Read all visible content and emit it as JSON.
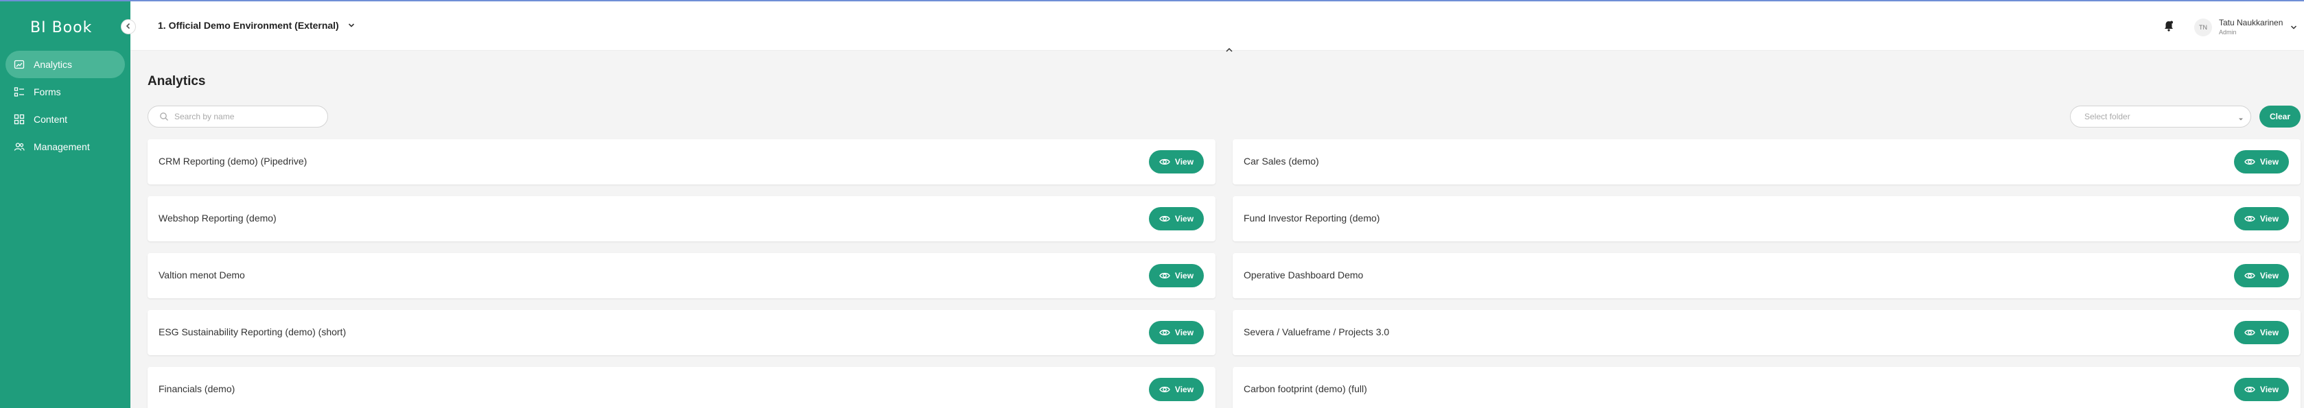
{
  "app": {
    "logo_text": "BI Book"
  },
  "sidebar": {
    "items": [
      {
        "label": "Analytics",
        "icon": "chart-icon",
        "active": true
      },
      {
        "label": "Forms",
        "icon": "forms-icon",
        "active": false
      },
      {
        "label": "Content",
        "icon": "grid-icon",
        "active": false
      },
      {
        "label": "Management",
        "icon": "users-icon",
        "active": false
      }
    ]
  },
  "header": {
    "environment": "1. Official Demo Environment (External)",
    "user": {
      "name": "Tatu Naukkarinen",
      "role": "Admin",
      "initials": "TN"
    }
  },
  "main": {
    "title": "Analytics",
    "search": {
      "placeholder": "Search by name",
      "value": ""
    },
    "folder_select": {
      "placeholder": "Select folder"
    },
    "clear_label": "Clear",
    "view_label": "View",
    "reports_left": [
      "CRM Reporting (demo) (Pipedrive)",
      "Webshop Reporting (demo)",
      "Valtion menot Demo",
      "ESG Sustainability Reporting (demo) (short)",
      "Financials (demo)"
    ],
    "reports_right": [
      "Car Sales (demo)",
      "Fund Investor Reporting (demo)",
      "Operative Dashboard Demo",
      "Severa / Valueframe / Projects 3.0",
      "Carbon footprint (demo) (full)"
    ]
  },
  "colors": {
    "brand": "#1f9d7c",
    "sidebar_active": "#4ab597",
    "background": "#f4f4f4"
  }
}
